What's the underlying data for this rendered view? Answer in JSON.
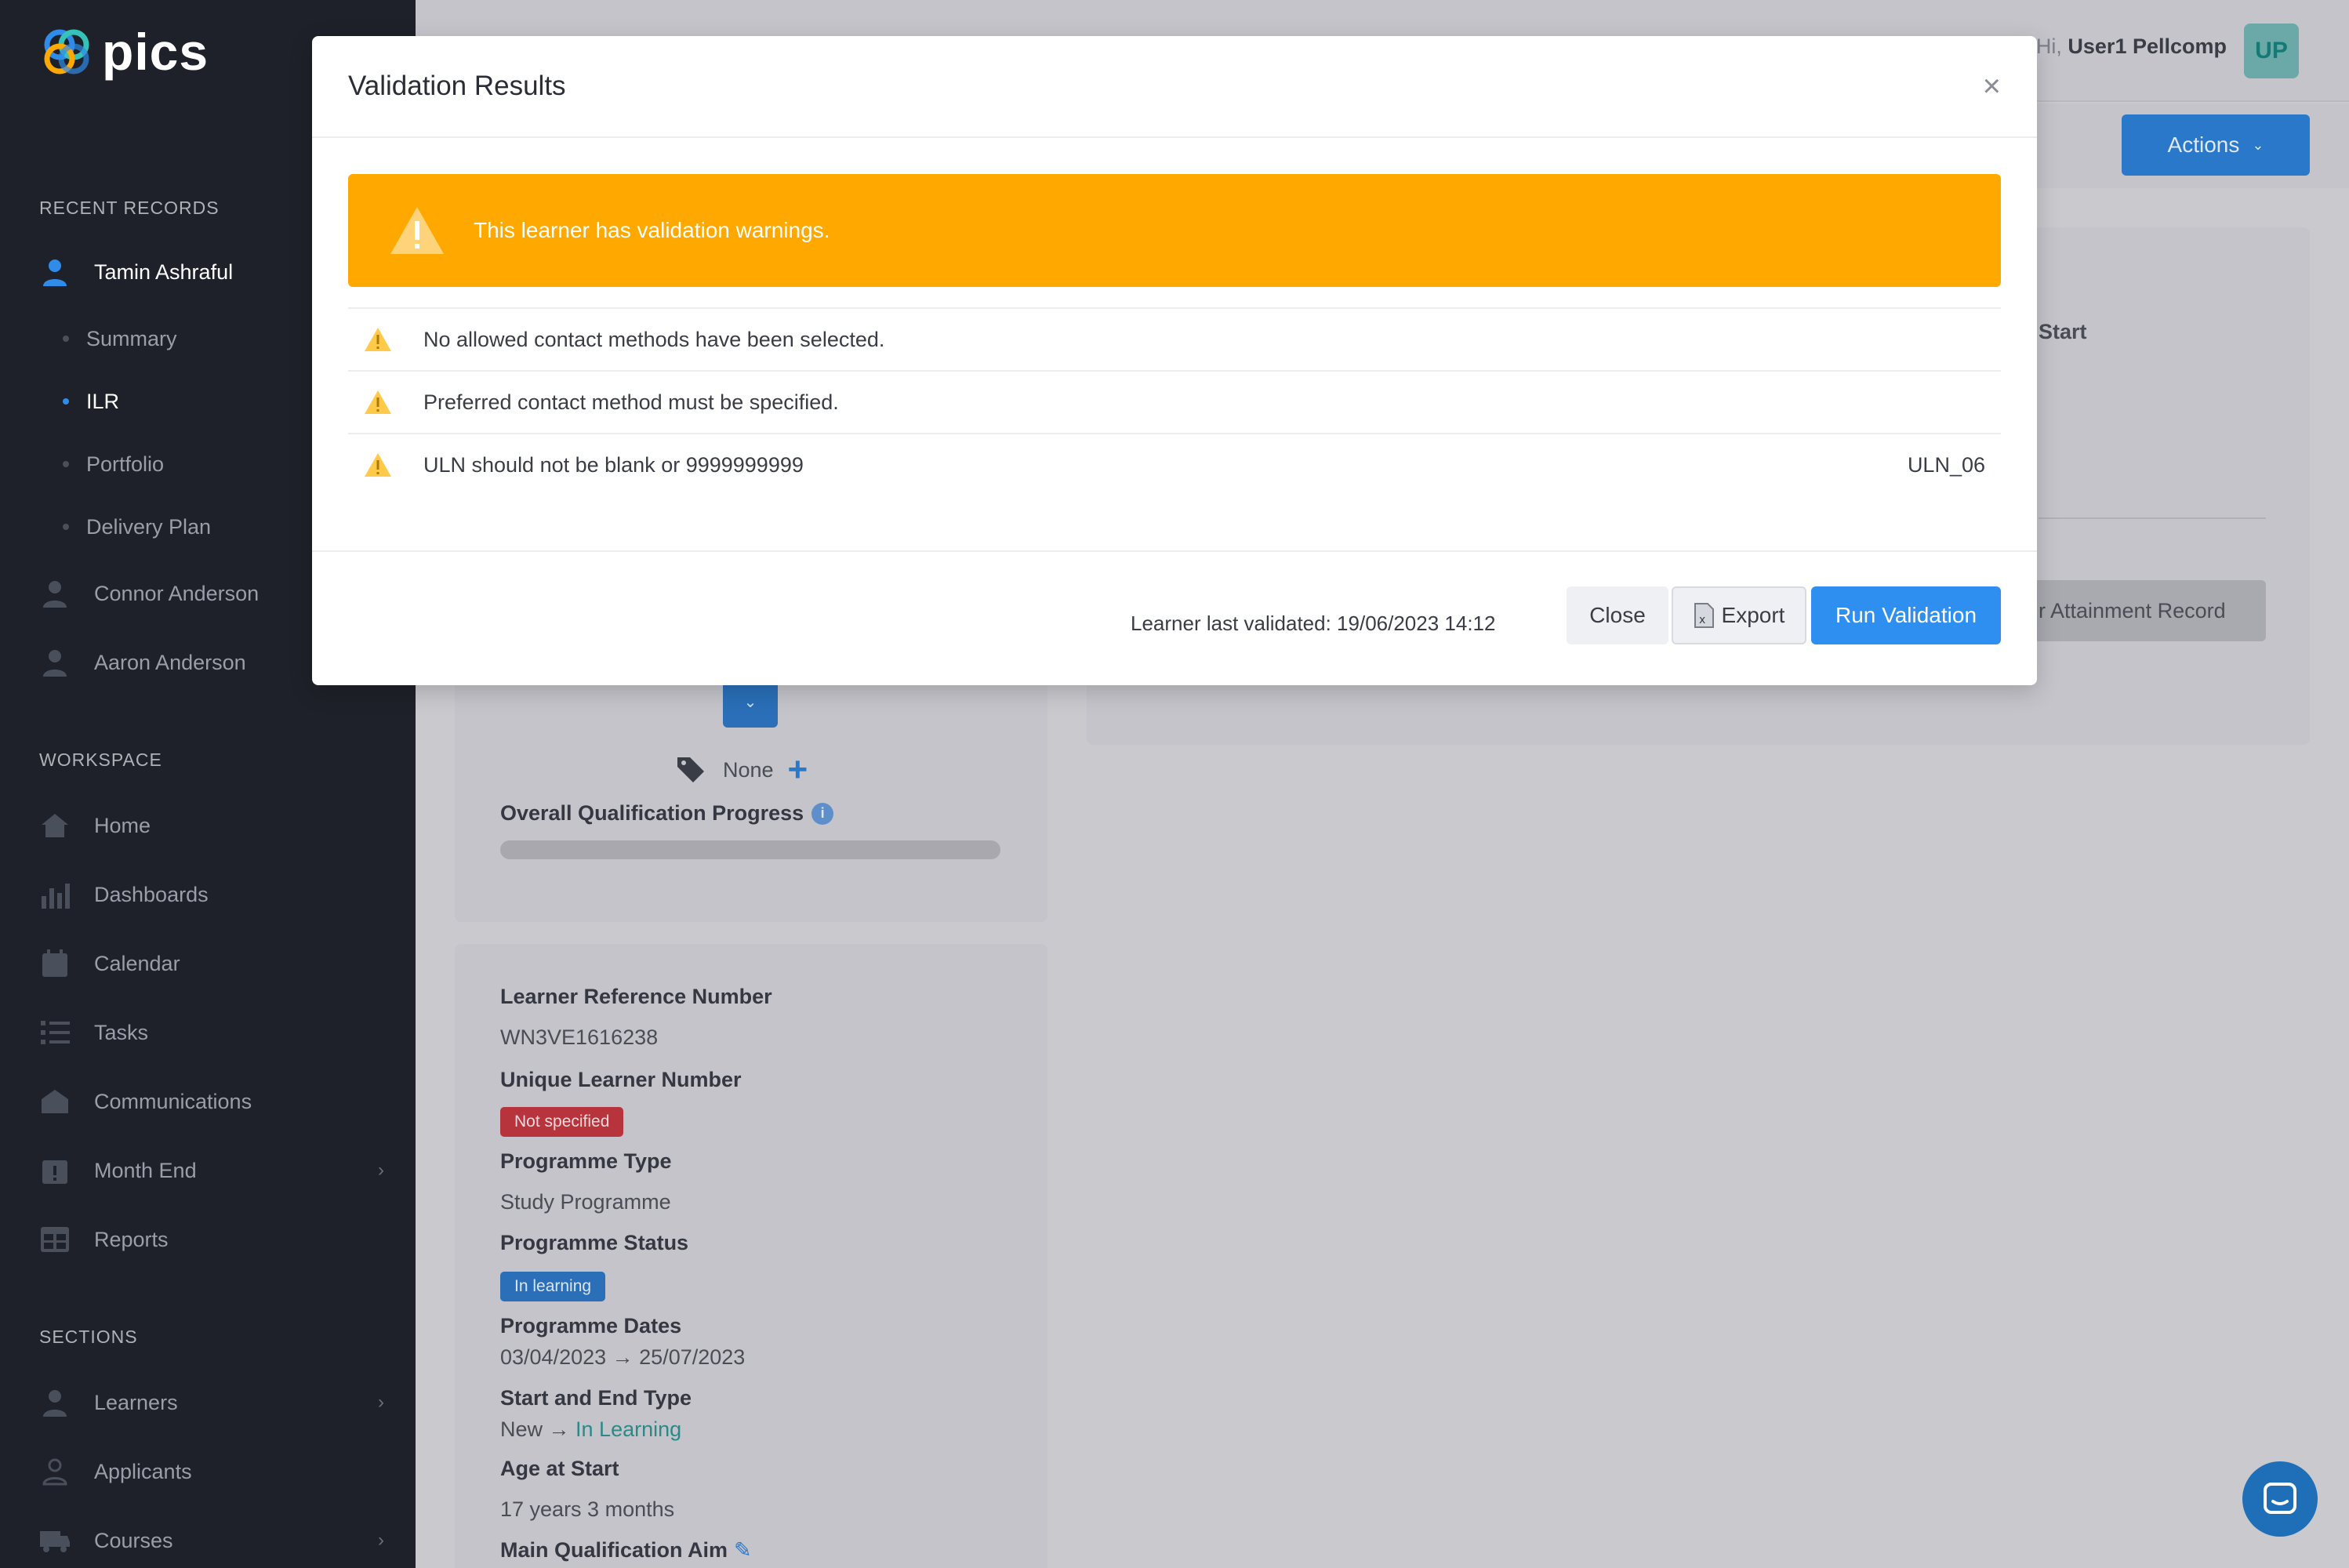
{
  "app": {
    "logo_text": "pics"
  },
  "sidebar": {
    "recent_header": "RECENT RECORDS",
    "recent": [
      {
        "label": "Tamin Ashraful"
      },
      {
        "label": "Connor Anderson"
      },
      {
        "label": "Aaron Anderson"
      }
    ],
    "sub_items": [
      {
        "label": "Summary"
      },
      {
        "label": "ILR"
      },
      {
        "label": "Portfolio"
      },
      {
        "label": "Delivery Plan"
      }
    ],
    "workspace_header": "WORKSPACE",
    "workspace": [
      {
        "label": "Home"
      },
      {
        "label": "Dashboards"
      },
      {
        "label": "Calendar"
      },
      {
        "label": "Tasks"
      },
      {
        "label": "Communications"
      },
      {
        "label": "Month End"
      },
      {
        "label": "Reports"
      }
    ],
    "sections_header": "SECTIONS",
    "sections": [
      {
        "label": "Learners"
      },
      {
        "label": "Applicants"
      },
      {
        "label": "Courses"
      }
    ]
  },
  "header": {
    "greeting_prefix": "Hi,",
    "user_name": "User1 Pellcomp",
    "avatar_initials": "UP",
    "actions_label": "Actions"
  },
  "main": {
    "start_label": "Start",
    "attainment_button": "r Attainment Record",
    "tag_value": "None",
    "overall_progress_label": "Overall Qualification Progress",
    "overall_progress_value": 0,
    "fields": {
      "lrn_label": "Learner Reference Number",
      "lrn_value": "WN3VE1616238",
      "uln_label": "Unique Learner Number",
      "uln_badge": "Not specified",
      "prog_type_label": "Programme Type",
      "prog_type_value": "Study Programme",
      "prog_status_label": "Programme Status",
      "prog_status_badge": "In learning",
      "prog_dates_label": "Programme Dates",
      "prog_start": "03/04/2023",
      "prog_end": "25/07/2023",
      "start_end_label": "Start and End Type",
      "start_type": "New",
      "end_type": "In Learning",
      "age_label": "Age at Start",
      "age_value": "17 years 3 months",
      "main_aim_label": "Main Qualification Aim"
    }
  },
  "modal": {
    "title": "Validation Results",
    "alert_text": "This learner has validation warnings.",
    "warnings": [
      {
        "text": "No allowed contact methods have been selected.",
        "code": ""
      },
      {
        "text": "Preferred contact method must be specified.",
        "code": ""
      },
      {
        "text": "ULN should not be blank or 9999999999",
        "code": "ULN_06"
      }
    ],
    "last_validated": "Learner last validated: 19/06/2023 14:12",
    "close_label": "Close",
    "export_label": "Export",
    "run_label": "Run Validation"
  },
  "colors": {
    "accent": "#2f8ff0",
    "warning": "#ffa800",
    "sidebar_bg": "#1e2129"
  }
}
